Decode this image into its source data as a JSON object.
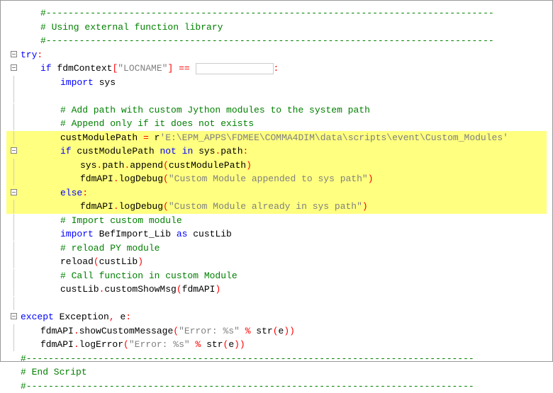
{
  "lines": {
    "l1": "#---------------------------------------------------------------------------------",
    "l2": "# Using external function library",
    "l3": "#---------------------------------------------------------------------------------",
    "l4_kw1": "try",
    "l5_kw1": "if",
    "l5_txt1": " fdmContext",
    "l5_str1": "\"LOCNAME\"",
    "l5_op1": "==",
    "l6_kw1": "import",
    "l6_txt1": " sys",
    "l8": "# Add path with custom Jython modules to the system path",
    "l9": "# Append only if it does not exists",
    "l10_txt1": "custModulePath ",
    "l10_op1": "=",
    "l10_txt2": " r",
    "l10_str1": "'E:\\EPM_APPS\\FDMEE\\COMMA4DIM\\data\\scripts\\event\\Custom_Modules'",
    "l11_kw1": "if",
    "l11_txt1": " custModulePath ",
    "l11_kw2": "not",
    "l11_txt2": " ",
    "l11_kw3": "in",
    "l11_txt3": " sys",
    "l11_txt4": "path",
    "l12_txt1": "sys",
    "l12_txt2": "path",
    "l12_txt3": "append",
    "l12_txt4": "custModulePath",
    "l13_txt1": "fdmAPI",
    "l13_txt2": "logDebug",
    "l13_str1": "\"Custom Module appended to sys path\"",
    "l14_kw1": "else",
    "l15_txt1": "fdmAPI",
    "l15_txt2": "logDebug",
    "l15_str1": "\"Custom Module already in sys path\"",
    "l16": "# Import custom module",
    "l17_kw1": "import",
    "l17_txt1": " BefImport_Lib ",
    "l17_kw2": "as",
    "l17_txt2": " custLib",
    "l18": "# reload PY module",
    "l19_txt1": "reload",
    "l19_txt2": "custLib",
    "l20": "# Call function in custom Module",
    "l21_txt1": "custLib",
    "l21_txt2": "customShowMsg",
    "l21_txt3": "fdmAPI",
    "l23_kw1": "except",
    "l23_txt1": " Exception",
    "l23_op1": ",",
    "l23_txt2": " e",
    "l24_txt1": "fdmAPI",
    "l24_txt2": "showCustomMessage",
    "l24_str1": "\"Error: %s\"",
    "l24_op1": " % ",
    "l24_txt3": "str",
    "l24_txt4": "e",
    "l25_txt1": "fdmAPI",
    "l25_txt2": "logError",
    "l25_str1": "\"Error: %s\"",
    "l25_op1": " % ",
    "l25_txt3": "str",
    "l25_txt4": "e",
    "l26": "#---------------------------------------------------------------------------------",
    "l27": "# End Script",
    "l28": "#---------------------------------------------------------------------------------"
  }
}
